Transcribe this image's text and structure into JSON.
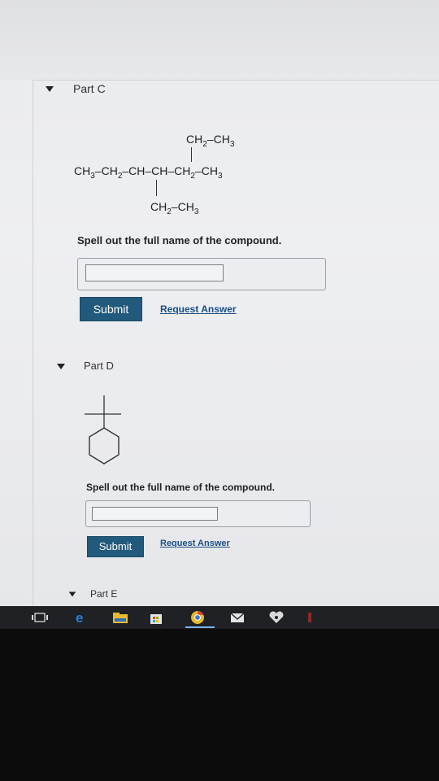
{
  "parts": {
    "c": {
      "title": "Part C",
      "formula": {
        "top_branch": [
          "CH",
          "2",
          "–CH",
          "3"
        ],
        "main_chain": [
          "CH",
          "3",
          "–CH",
          "2",
          "–CH–CH–CH",
          "2",
          "–CH",
          "3"
        ],
        "bottom_branch": [
          "CH",
          "2",
          "–CH",
          "3"
        ]
      },
      "question": "Spell out the full name of the compound.",
      "input_value": "",
      "submit_label": "Submit",
      "request_label": "Request Answer"
    },
    "d": {
      "title": "Part D",
      "question": "Spell out the full name of the compound.",
      "input_value": "",
      "submit_label": "Submit",
      "request_label": "Request Answer"
    },
    "e": {
      "title": "Part E"
    }
  },
  "taskbar": {
    "icons": [
      "task-view-icon",
      "edge-browser-icon",
      "file-explorer-icon",
      "store-icon",
      "chrome-icon",
      "mail-icon",
      "iheartradio-icon",
      "app-icon"
    ],
    "accent_color": "#7fb2e6"
  },
  "colors": {
    "submit": "#225a7d",
    "link": "#1a4f88",
    "page": "#eceef1"
  }
}
